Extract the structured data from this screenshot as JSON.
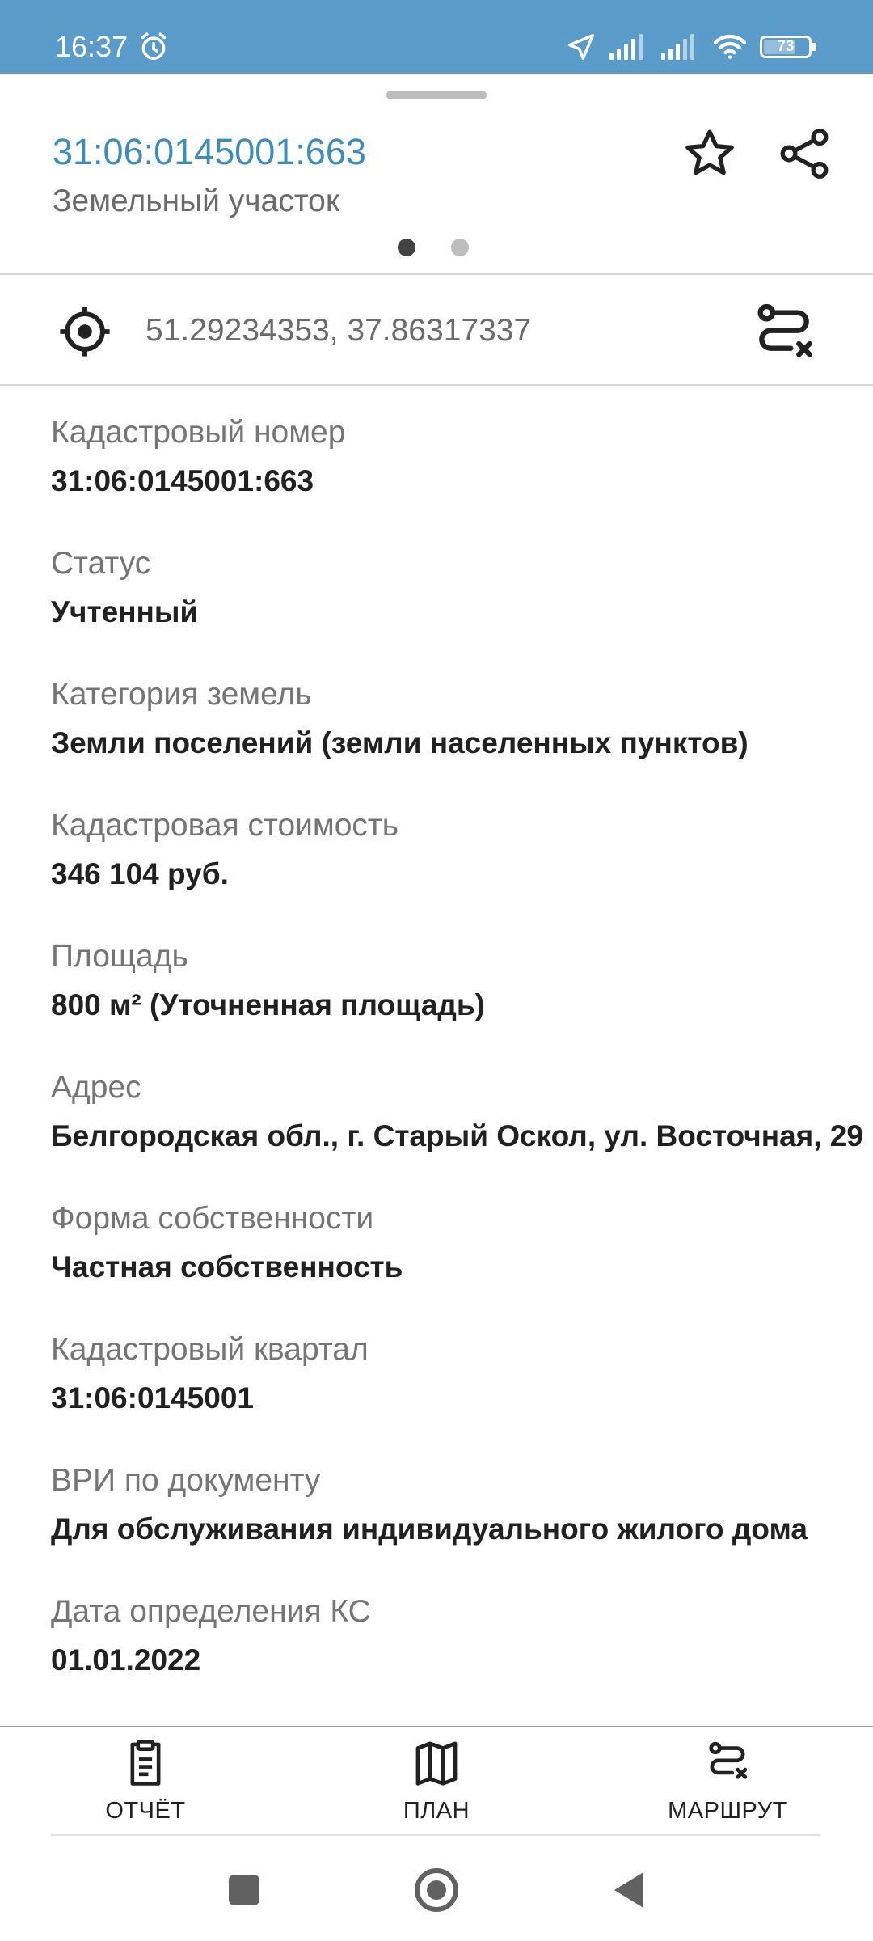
{
  "status_bar": {
    "time": "16:37",
    "battery": "73"
  },
  "header": {
    "title": "31:06:0145001:663",
    "subtitle": "Земельный участок",
    "icons": {
      "favorite": "star-icon",
      "share": "share-icon"
    }
  },
  "pager": {
    "pages": 2,
    "active": 1
  },
  "location": {
    "coordinates": "51.29234353, 37.86317337"
  },
  "properties": [
    {
      "label": "Кадастровый номер",
      "value": "31:06:0145001:663"
    },
    {
      "label": "Статус",
      "value": "Учтенный"
    },
    {
      "label": "Категория земель",
      "value": "Земли поселений (земли населенных пунктов)"
    },
    {
      "label": "Кадастровая стоимость",
      "value": "346 104 руб."
    },
    {
      "label": "Площадь",
      "value": "800 м² (Уточненная площадь)"
    },
    {
      "label": "Адрес",
      "value": "Белгородская обл., г. Старый Оскол, ул. Восточная, 29"
    },
    {
      "label": "Форма собственности",
      "value": "Частная собственность"
    },
    {
      "label": "Кадастровый квартал",
      "value": "31:06:0145001"
    },
    {
      "label": "ВРИ по документу",
      "value": "Для обслуживания индивидуального жилого дома"
    },
    {
      "label": "Дата определения КС",
      "value": "01.01.2022"
    }
  ],
  "bottom_nav": [
    {
      "label": "ОТЧЁТ",
      "icon": "report-icon"
    },
    {
      "label": "ПЛАН",
      "icon": "map-icon"
    },
    {
      "label": "МАРШРУТ",
      "icon": "route-icon"
    }
  ],
  "colors": {
    "status_bar": "#5b9bc9",
    "title": "#3f8cb8"
  }
}
